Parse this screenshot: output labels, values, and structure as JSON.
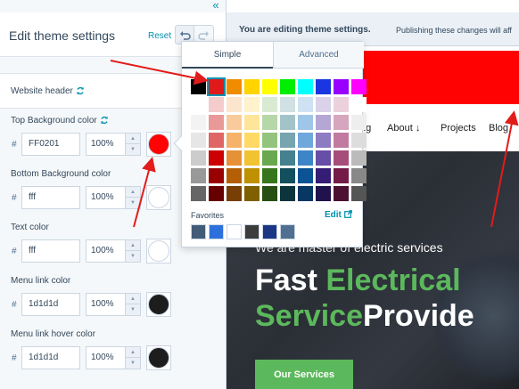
{
  "panel": {
    "title": "Edit theme settings",
    "reset_label": "Reset",
    "collapse_glyph": "«",
    "section_title": "Website header",
    "fields": [
      {
        "label": "Top Background color",
        "hex": "FF0201",
        "opacity": "100%",
        "swatch": "#ff0201",
        "sync": true
      },
      {
        "label": "Bottom Background color",
        "hex": "fff",
        "opacity": "100%",
        "swatch": "#ffffff",
        "sync": false
      },
      {
        "label": "Text color",
        "hex": "fff",
        "opacity": "100%",
        "swatch": "#ffffff",
        "sync": false
      },
      {
        "label": "Menu link color",
        "hex": "1d1d1d",
        "opacity": "100%",
        "swatch": "#1d1d1d",
        "sync": false
      },
      {
        "label": "Menu link hover color",
        "hex": "1d1d1d",
        "opacity": "100%",
        "swatch": "#1d1d1d",
        "sync": false
      }
    ],
    "hash": "#"
  },
  "banner": {
    "bold": "You are editing theme settings.",
    "rest": "Publishing these changes will aff"
  },
  "nav": {
    "links": [
      "ng",
      "About",
      "Projects",
      "Blog"
    ],
    "about_arrow": "↓"
  },
  "hero": {
    "subtitle": "We are master of electric services",
    "line1_white": "Fast ",
    "line1_green": "Electrical",
    "line2_green": "Service",
    "line2_white": "Provide",
    "button": "Our Services"
  },
  "picker": {
    "tabs": [
      "Simple",
      "Advanced"
    ],
    "active_tab": "Simple",
    "palette": [
      [
        "#000000",
        "#e01a1a",
        "#f08c00",
        "#ffd400",
        "#ffff00",
        "#00ee00",
        "#00ffff",
        "#1a36e0",
        "#9900ff",
        "#ff00ff"
      ],
      [
        "#ffffff",
        "#f4cccc",
        "#fce5cd",
        "#fff2cc",
        "#d9ead3",
        "#d0e0e3",
        "#cfe2f3",
        "#d9d2e9",
        "#ead1dc",
        "#ffffff"
      ],
      [
        "#f3f3f3",
        "#ea9999",
        "#f9cb9c",
        "#ffe599",
        "#b6d7a8",
        "#a2c4c9",
        "#9fc5e8",
        "#b4a7d6",
        "#d5a6bd",
        "#eeeeee"
      ],
      [
        "#e6e6e6",
        "#e06666",
        "#f6b26b",
        "#ffd966",
        "#93c47d",
        "#76a5af",
        "#6fa8dc",
        "#8e7cc3",
        "#c27ba0",
        "#dddddd"
      ],
      [
        "#cccccc",
        "#cc0000",
        "#e69138",
        "#f1c232",
        "#6aa84f",
        "#45818e",
        "#3d85c6",
        "#674ea7",
        "#a64d79",
        "#bbbbbb"
      ],
      [
        "#999999",
        "#990000",
        "#b45f06",
        "#bf9000",
        "#38761d",
        "#134f5c",
        "#0b5394",
        "#351c75",
        "#741b47",
        "#888888"
      ],
      [
        "#666666",
        "#660000",
        "#783f04",
        "#7f6000",
        "#274e13",
        "#0c343d",
        "#073763",
        "#20124d",
        "#4c1130",
        "#555555"
      ]
    ],
    "selected": [
      0,
      1
    ],
    "favorites_label": "Favorites",
    "edit_label": "Edit",
    "favorites": [
      "#425b76",
      "#2d6fdb",
      "#ffffff",
      "#3c3c3c",
      "#1a3685",
      "#516f90"
    ]
  },
  "colors": {
    "accent": "#0091ae",
    "annotation": "#e21b1b"
  }
}
